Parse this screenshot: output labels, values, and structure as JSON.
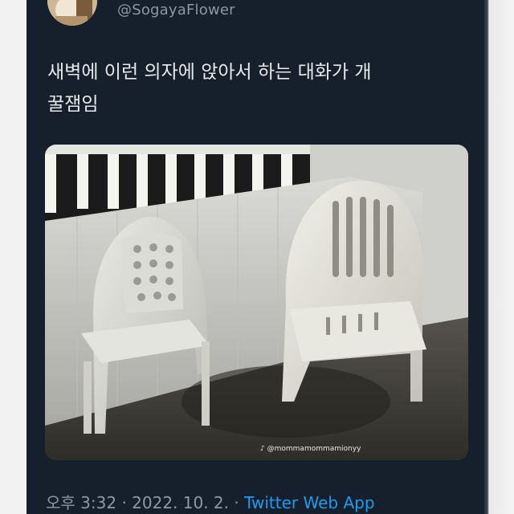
{
  "tweet": {
    "handle": "@SogayaFlower",
    "text": "새벽에 이런 의자에 앉아서 하는 대화가 개\n꿀잼임",
    "time": "오후 3:32",
    "separator1": "·",
    "date": "2022. 10. 2.",
    "separator2": "·",
    "source": "Twitter Web App"
  },
  "media": {
    "watermark": "@mommamommamionyy",
    "watermark_icon": "tiktok-icon",
    "description_icons": [
      "avatar"
    ]
  },
  "colors": {
    "background": "#16202c",
    "text": "#e7e9ea",
    "muted": "#8b98a5",
    "link": "#1d9bf0"
  }
}
